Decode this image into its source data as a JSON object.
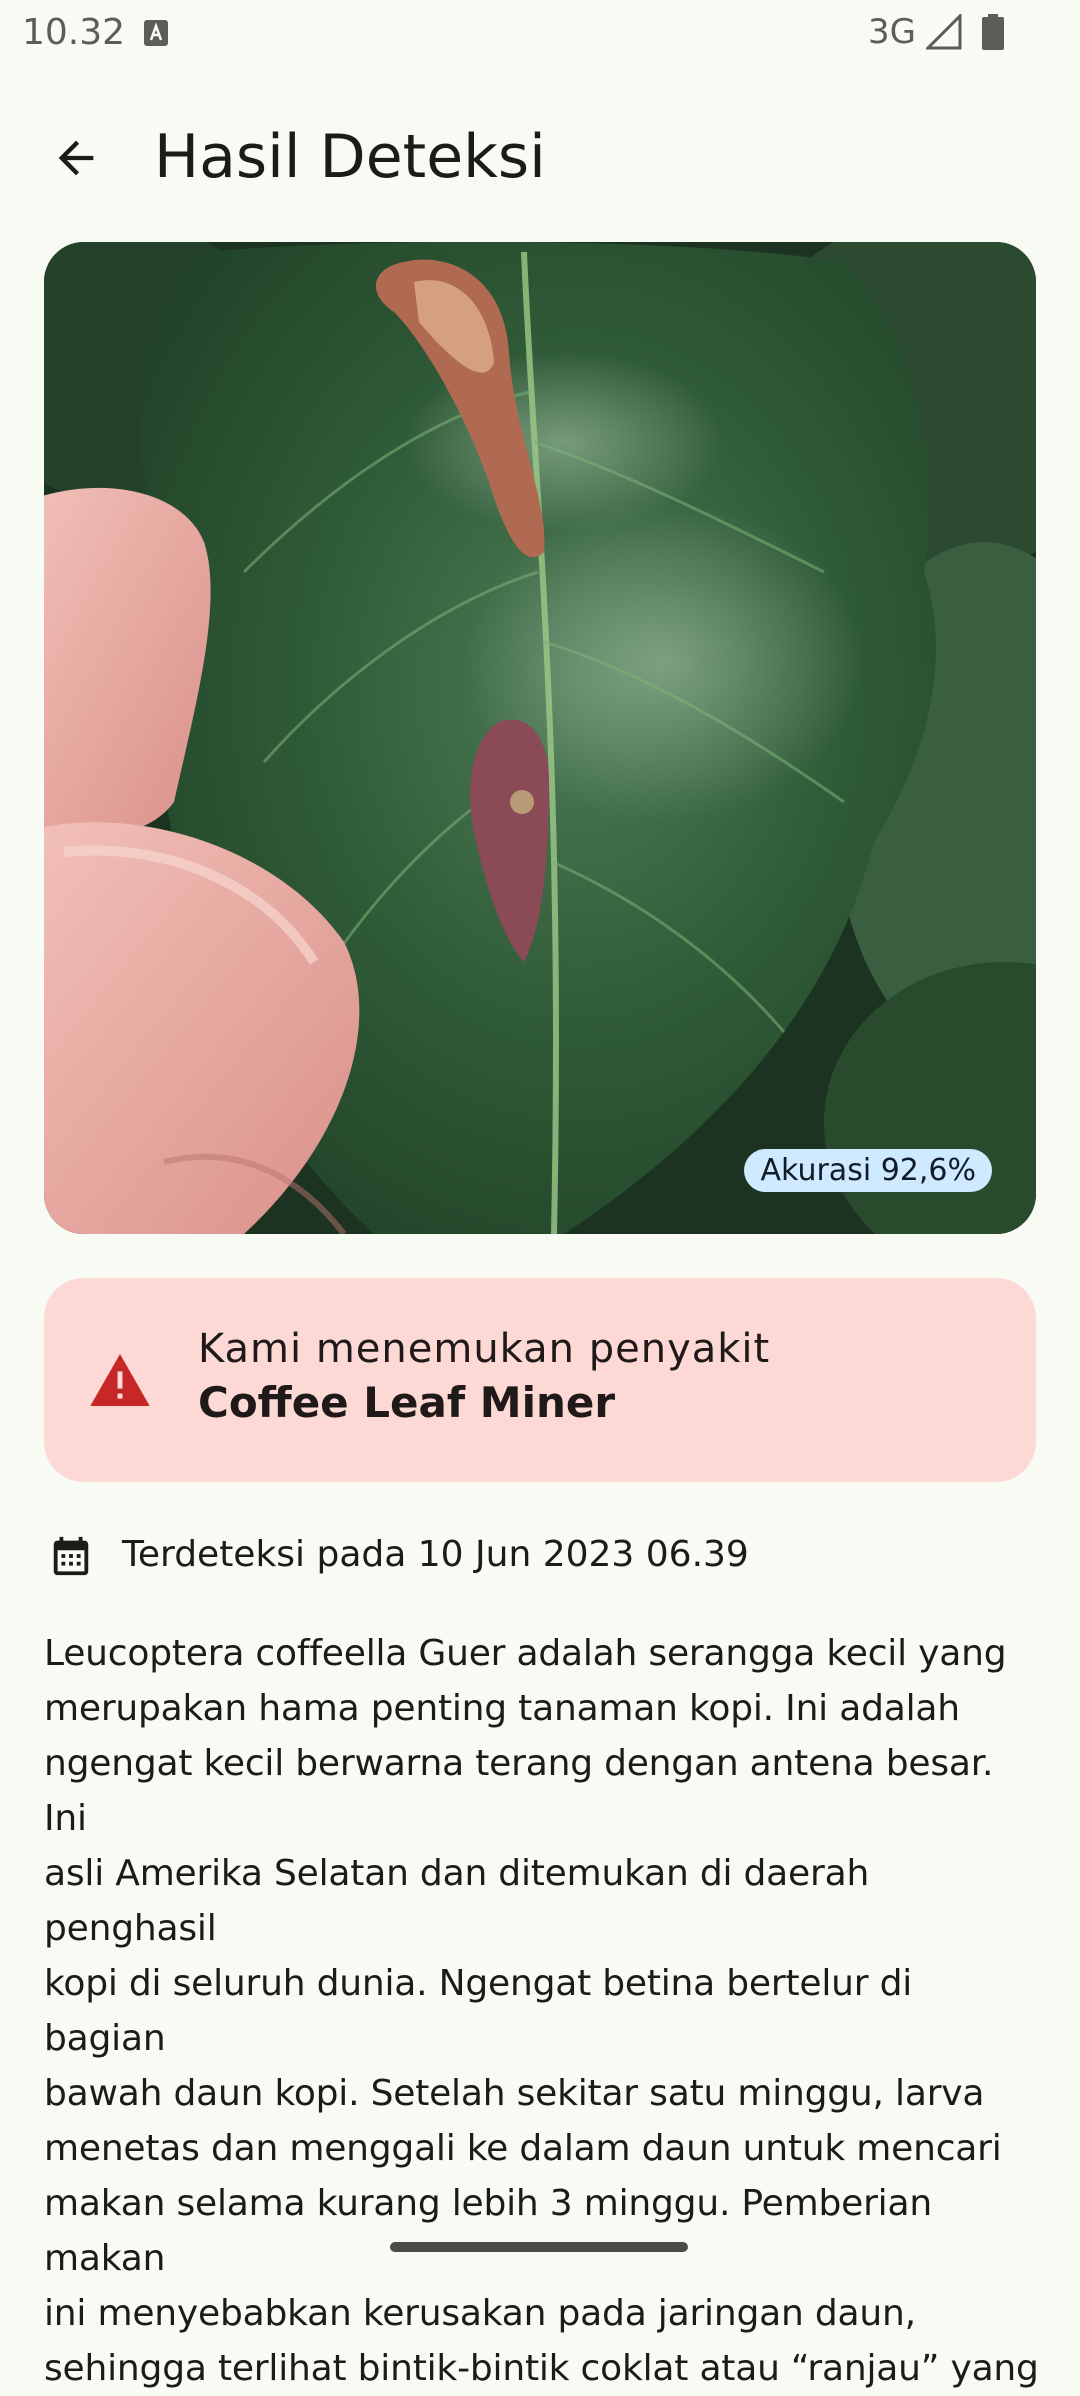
{
  "status_bar": {
    "time": "10.32",
    "network": "3G",
    "icons": [
      "notification-a-icon",
      "signal-icon",
      "battery-icon"
    ]
  },
  "header": {
    "back_icon": "arrow-back-icon",
    "title": "Hasil Deteksi"
  },
  "result": {
    "image_description_icon": "coffee-leaf-photo",
    "accuracy_label": "Akurasi 92,6%",
    "card": {
      "icon": "warning-triangle-icon",
      "lead": "Kami menemukan penyakit",
      "disease_name": "Coffee Leaf Miner"
    },
    "detected": {
      "icon": "calendar-icon",
      "text": "Terdeteksi pada 10 Jun 2023 06.39"
    },
    "description_lines": [
      "Leucoptera coffeella Guer adalah serangga kecil yang",
      "merupakan hama penting tanaman kopi. Ini adalah",
      "ngengat kecil berwarna terang dengan antena besar. Ini",
      "asli Amerika Selatan dan ditemukan di daerah penghasil",
      "kopi di seluruh dunia. Ngengat betina bertelur di bagian",
      "bawah daun kopi. Setelah sekitar satu minggu, larva",
      "menetas dan menggali ke dalam daun untuk mencari",
      "makan selama kurang lebih 3 minggu. Pemberian makan",
      "ini menyebabkan kerusakan pada jaringan daun,",
      "sehingga terlihat bintik-bintik coklat atau “ranjau” yang"
    ]
  },
  "colors": {
    "background": "#f7fbf4",
    "card_background": "#fdd9d6",
    "warning": "#c62828",
    "chip_background": "#cfe9ff"
  }
}
